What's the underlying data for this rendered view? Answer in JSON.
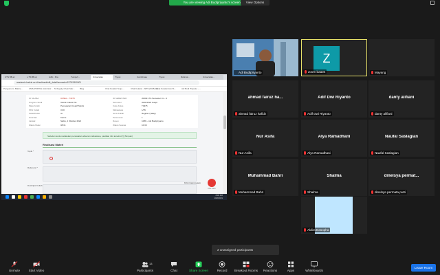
{
  "banner": {
    "viewing": "You are viewing Adi Budipriyanto's screen",
    "view_options": "View Options"
  },
  "shared_screen": {
    "tabs": [
      "UTS BB-ar",
      "L.TS BB-ar",
      "Adhi • Pos",
      "Tumpuh...",
      "Universitas",
      "Tryout",
      "Cari Elmaa",
      "Tryout",
      "Rahmat...",
      "Universitas..."
    ],
    "url": "academic.bakrie.ac.id/realisasi/edit_detail/semester/1575/1500001",
    "bookmarks": [
      "Pengumum. Bakrie…",
      "CMS-PORTAL Administr…",
      "M-Supply Chain Mar…",
      "Blog",
      "Chat Koleksi Tenjo…",
      "Chat Koleksi - SPIS (SUBAG)",
      "Chat Koleksi dan IS…",
      "Adi Budi Priyanto –…"
    ],
    "details_left": [
      {
        "label": "ID SILABA",
        "value": ""
      },
      {
        "label": "Program Studi",
        "value": "Teknik Industri S1"
      },
      {
        "label": "Mata Kuliah",
        "value": "Pemasaran Kreatif Teknik"
      },
      {
        "label": "SKS Kuliah",
        "value": "3.00"
      },
      {
        "label": "Kelas/Kelas",
        "value": "IA"
      },
      {
        "label": "Hari/Jam",
        "value": "Kamis"
      },
      {
        "label": "Jadwal",
        "value": "Sabtu, 2 Oktober 2021"
      },
      {
        "label": "Waktu Mulai",
        "value": "08:31"
      }
    ],
    "details_left_head": "02TEA – T3975",
    "details_right": [
      {
        "label": "ID SEMESTER",
        "value": "202021 TA Semester Ini – 9"
      },
      {
        "label": "Semester",
        "value": "2021/2022 Ganjil"
      },
      {
        "label": "Kode Kelas",
        "value": "T3975"
      },
      {
        "label": "Mahasiswa",
        "value": "1/35"
      },
      {
        "label": "Jenis Kuliah",
        "value": "Reguler (Tatap)"
      },
      {
        "label": "Pertemuan",
        "value": "1"
      },
      {
        "label": "Dosen",
        "value": "1089 – Adi Budipriyanto"
      },
      {
        "label": "Waktu Selesai",
        "value": "10:30"
      }
    ],
    "alert_text": "Sebelum anda melakukan pencatatan absensi mahasiswa, pastikan info tersebut [!] (Simpan)",
    "realisasi_title": "Realisasi Materi",
    "field_labels": [
      "Topik *",
      "Referensi *",
      "Deskripsi Kuliah *"
    ],
    "chat_label": "Ada yang bisa kami bantu? • Tanya di sini • Kirimi kami pesan",
    "chat_short": "Kirimi kami pesan",
    "chat_sub": "Chat Kami",
    "time": "8:09 PM",
    "date": "10/2/2021"
  },
  "participants": [
    {
      "display": "",
      "label": "Adi Budipriyanto",
      "muted": false,
      "kind": "video"
    },
    {
      "display": "Z",
      "label": "zoom baa04",
      "muted": true,
      "kind": "avatar",
      "active": true
    },
    {
      "display": "",
      "label": "Mayang",
      "muted": true,
      "kind": "blank"
    },
    {
      "display": "ahmad fairuz ha...",
      "label": "ahmad fairuz hafidz",
      "muted": true,
      "kind": "name"
    },
    {
      "display": "Adif Dwi Riyanto",
      "label": "Adif Dwi Riyanto",
      "muted": true,
      "kind": "name"
    },
    {
      "display": "danty alifiani",
      "label": "danty alifiani",
      "muted": true,
      "kind": "name"
    },
    {
      "display": "Nur Asifa",
      "label": "Nur Asifa",
      "muted": true,
      "kind": "name"
    },
    {
      "display": "Alya Ramadhani",
      "label": "Alya Ramadhani",
      "muted": true,
      "kind": "name"
    },
    {
      "display": "Naufal Saslagian",
      "label": "Naufal Saslagian",
      "muted": true,
      "kind": "name"
    },
    {
      "display": "Muhammad Bahri",
      "label": "Muhammad Bahri",
      "muted": true,
      "kind": "name"
    },
    {
      "display": "Shalma",
      "label": "Shalma",
      "muted": true,
      "kind": "name"
    },
    {
      "display": "dinelsya permat...",
      "label": "dinelsya permata putri",
      "muted": true,
      "kind": "name"
    },
    {
      "display": "",
      "label": "Aldira Dasopha",
      "muted": true,
      "kind": "video-blue"
    }
  ],
  "unassigned": "2 unassigned participants",
  "toolbar": {
    "unmute": "Unmute",
    "start_video": "Start Video",
    "participants": "Participants",
    "participants_count": "13",
    "chat": "Chat",
    "share_screen": "Share Screen",
    "record": "Record",
    "breakout_rooms": "Breakout Rooms",
    "reactions": "Reactions",
    "apps": "Apps",
    "whiteboards": "Whiteboards",
    "leave": "Leave Room"
  },
  "colors": {
    "banner_green": "#22a84a",
    "active_border": "#e8e26a",
    "avatar_teal": "#0e9aa7",
    "leave_blue": "#1a73e8",
    "muted_red": "#e33333"
  }
}
